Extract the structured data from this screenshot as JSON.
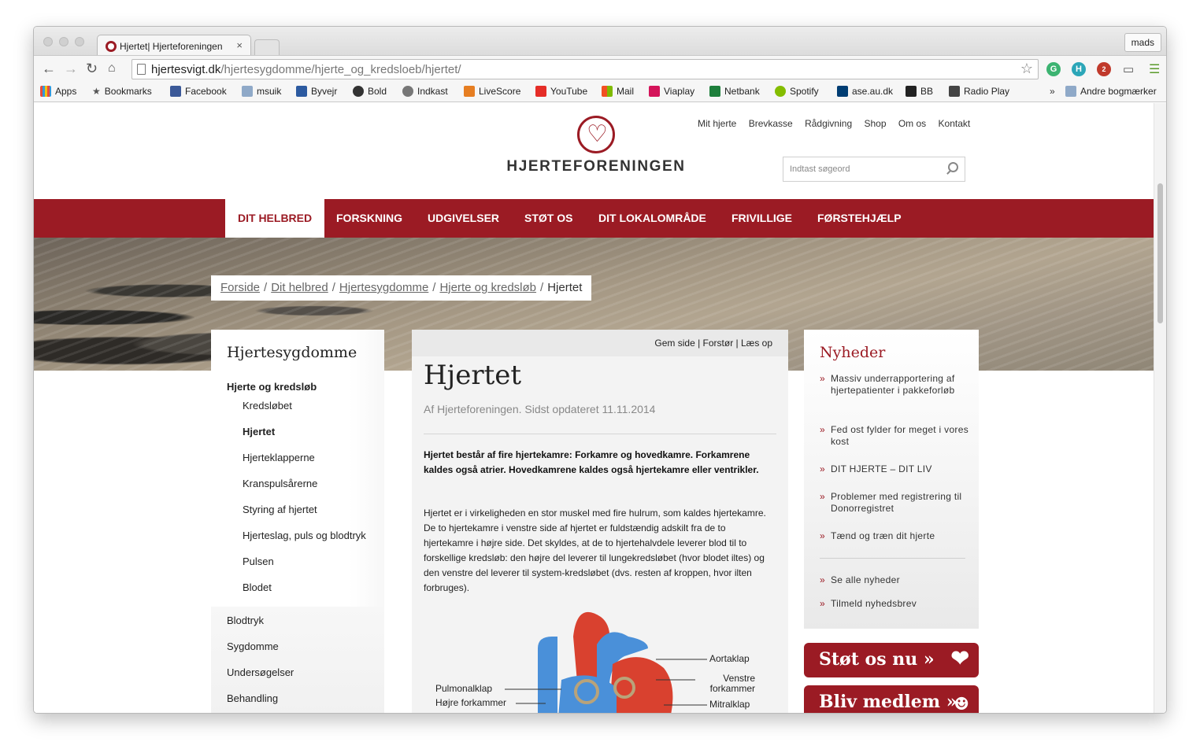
{
  "browser": {
    "tab_title": "Hjertet| Hjerteforeningen",
    "tab_close": "×",
    "profile": "mads",
    "url_host": "hjertesvigt.dk",
    "url_path": "/hjertesygdomme/hjerte_og_kredsloeb/hjertet/",
    "bookmarks": [
      "Apps",
      "Bookmarks",
      "Facebook",
      "msuik",
      "Byvejr",
      "Bold",
      "Indkast",
      "LiveScore",
      "YouTube",
      "Mail",
      "Viaplay",
      "Netbank",
      "Spotify",
      "ase.au.dk",
      "BB",
      "Radio Play"
    ],
    "bookmarks_more": "»",
    "other_bookmarks": "Andre bogmærker",
    "extension_badge": "2"
  },
  "site": {
    "logo_text": "HJERTEFORENINGEN",
    "top_links": [
      "Mit hjerte",
      "Brevkasse",
      "Rådgivning",
      "Shop",
      "Om os",
      "Kontakt"
    ],
    "search_placeholder": "Indtast søgeord",
    "nav": [
      "DIT HELBRED",
      "FORSKNING",
      "UDGIVELSER",
      "STØT OS",
      "DIT LOKALOMRÅDE",
      "FRIVILLIGE",
      "FØRSTEHJÆLP"
    ],
    "breadcrumb": [
      "Forside",
      "Dit helbred",
      "Hjertesygdomme",
      "Hjerte og kredsløb"
    ],
    "breadcrumb_sep": "/",
    "breadcrumb_current": "Hjertet"
  },
  "sidebar": {
    "title": "Hjertesygdomme",
    "section": "Hjerte og kredsløb",
    "sub_items": [
      "Kredsløbet",
      "Hjertet",
      "Hjerteklapperne",
      "Kranspulsårerne",
      "Styring af hjertet",
      "Hjerteslag, puls og blodtryk",
      "Pulsen",
      "Blodet"
    ],
    "other_sections": [
      "Blodtryk",
      "Sygdomme",
      "Undersøgelser",
      "Behandling"
    ]
  },
  "article": {
    "tools": "Gem side | Forstør | Læs op",
    "title": "Hjertet",
    "byline": "Af Hjerteforeningen. Sidst opdateret 11.11.2014",
    "lead": "Hjertet består af fire hjertekamre: Forkamre og hovedkamre. Forkamrene kaldes også atrier. Hovedkamrene kaldes også hjertekamre eller ventrikler.",
    "body": "Hjertet er i virkeligheden en stor muskel med fire hulrum, som kaldes hjertekamre. De to hjertekamre i venstre side af hjertet er fuldstændig adskilt fra de to hjertekamre i højre side. Det skyldes, at de to hjertehalvdele leverer blod til to forskellige kredsløb: den højre del leverer til lungekredsløbet (hvor blodet iltes) og den venstre del leverer til system-kredsløbet (dvs. resten af kroppen, hvor ilten forbruges).",
    "diagram_labels": {
      "aortaklap": "Aortaklap",
      "venstre_forkammer": "Venstre forkammer",
      "pulmonalklap": "Pulmonalklap",
      "hoejre_forkammer": "Højre forkammer",
      "mitralklap": "Mitralklap"
    }
  },
  "news": {
    "title": "Nyheder",
    "bullet": "»",
    "items": [
      "Massiv underrapportering af hjertepatienter i pakkeforløb",
      "Fed ost fylder for meget i vores kost",
      "DIT HJERTE – DIT LIV",
      "Problemer med registrering til Donorregistret",
      "Tænd og træn dit hjerte"
    ],
    "links": [
      "Se alle nyheder",
      "Tilmeld nyhedsbrev"
    ]
  },
  "cta": {
    "support": "Støt os nu »",
    "member": "Bliv medlem »"
  },
  "colors": {
    "brand_red": "#9b1b24"
  }
}
